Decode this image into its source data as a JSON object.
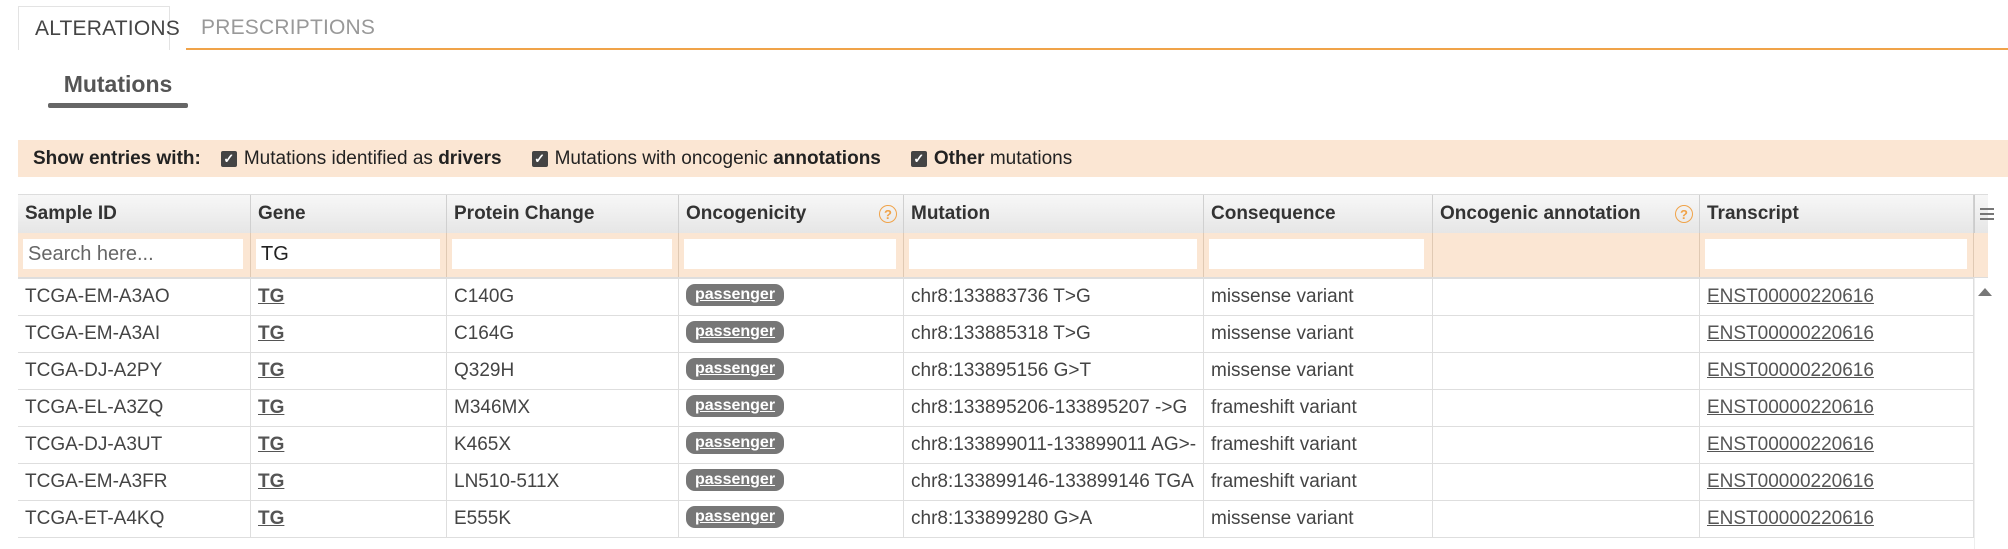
{
  "tabs": [
    {
      "label": "ALTERATIONS",
      "active": true
    },
    {
      "label": "PRESCRIPTIONS",
      "active": false
    }
  ],
  "subtab": {
    "label": "Mutations"
  },
  "filter": {
    "title": "Show entries with:",
    "options": [
      {
        "pre": "Mutations identified as ",
        "bold": "drivers",
        "post": "",
        "checked": true
      },
      {
        "pre": "Mutations with oncogenic ",
        "bold": "annotations",
        "post": "",
        "checked": true
      },
      {
        "pre": "",
        "bold": "Other",
        "post": " mutations",
        "checked": true
      }
    ]
  },
  "table": {
    "columns": [
      "Sample ID",
      "Gene",
      "Protein Change",
      "Oncogenicity",
      "Mutation",
      "Consequence",
      "Oncogenic annotation",
      "Transcript"
    ],
    "search": {
      "placeholder": "Search here...",
      "gene_value": "TG"
    },
    "rows": [
      {
        "sample": "TCGA-EM-A3AO",
        "gene": "TG",
        "protein": "C140G",
        "oncogenicity": "passenger",
        "mutation": "chr8:133883736 T>G",
        "consequence": "missense variant",
        "annotation": "",
        "transcript": "ENST00000220616"
      },
      {
        "sample": "TCGA-EM-A3AI",
        "gene": "TG",
        "protein": "C164G",
        "oncogenicity": "passenger",
        "mutation": "chr8:133885318 T>G",
        "consequence": "missense variant",
        "annotation": "",
        "transcript": "ENST00000220616"
      },
      {
        "sample": "TCGA-DJ-A2PY",
        "gene": "TG",
        "protein": "Q329H",
        "oncogenicity": "passenger",
        "mutation": "chr8:133895156 G>T",
        "consequence": "missense variant",
        "annotation": "",
        "transcript": "ENST00000220616"
      },
      {
        "sample": "TCGA-EL-A3ZQ",
        "gene": "TG",
        "protein": "M346MX",
        "oncogenicity": "passenger",
        "mutation": "chr8:133895206-133895207 ->G",
        "consequence": "frameshift variant",
        "annotation": "",
        "transcript": "ENST00000220616"
      },
      {
        "sample": "TCGA-DJ-A3UT",
        "gene": "TG",
        "protein": "K465X",
        "oncogenicity": "passenger",
        "mutation": "chr8:133899011-133899011 AG>-",
        "consequence": "frameshift variant",
        "annotation": "",
        "transcript": "ENST00000220616"
      },
      {
        "sample": "TCGA-EM-A3FR",
        "gene": "TG",
        "protein": "LN510-511X",
        "oncogenicity": "passenger",
        "mutation": "chr8:133899146-133899146 TGA",
        "consequence": "frameshift variant",
        "annotation": "",
        "transcript": "ENST00000220616"
      },
      {
        "sample": "TCGA-ET-A4KQ",
        "gene": "TG",
        "protein": "E555K",
        "oncogenicity": "passenger",
        "mutation": "chr8:133899280 G>A",
        "consequence": "missense variant",
        "annotation": "",
        "transcript": "ENST00000220616"
      }
    ]
  },
  "colors": {
    "accent": "#f0a349",
    "filter_bg": "#fbe6d3",
    "badge": "#777777"
  }
}
